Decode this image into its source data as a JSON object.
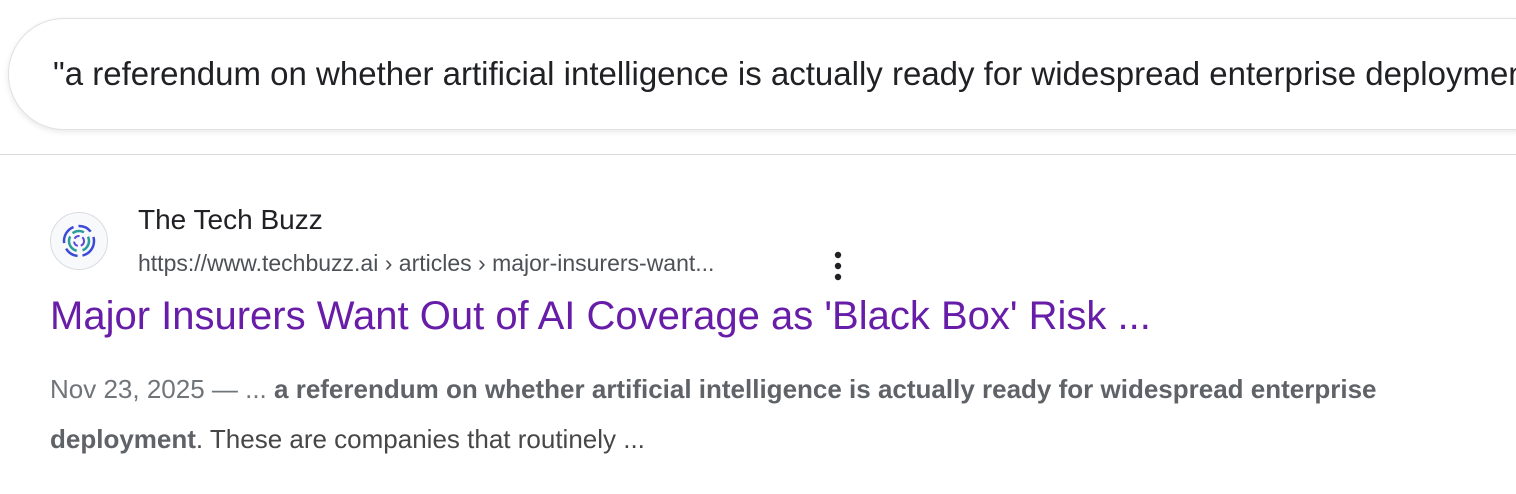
{
  "search": {
    "query": "\"a referendum on whether artificial intelligence is actually ready for widespread enterprise deployment\""
  },
  "result": {
    "favicon": "techbuzz-logo-icon",
    "site_name": "The Tech Buzz",
    "url": "https://www.techbuzz.ai › articles › major-insurers-want...",
    "more_icon": "three-dot-menu-icon",
    "title": "Major Insurers Want Out of AI Coverage as 'Black Box' Risk ...",
    "snippet": {
      "date_prefix": "Nov 23, 2025 — ... ",
      "bold_text": "a referendum on whether artificial intelligence is actually ready for widespread enterprise deployment",
      "trailing_text": ". These are companies that routinely ..."
    }
  },
  "colors": {
    "title_visited": "#681da8",
    "text": "#202124",
    "url": "#4d5156"
  }
}
